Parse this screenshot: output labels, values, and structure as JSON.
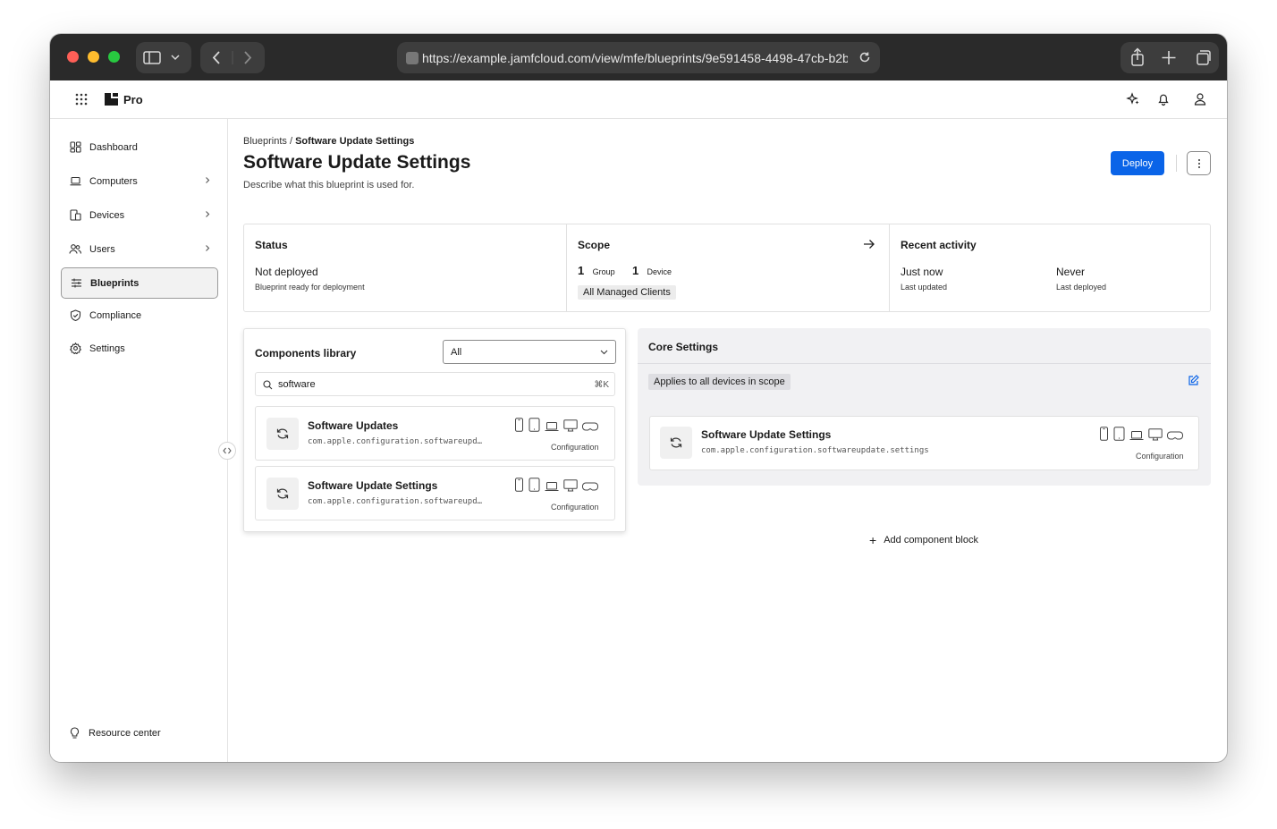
{
  "browser": {
    "url": "https://example.jamfcloud.com/view/mfe/blueprints/9e591458-4498-47cb-b2b"
  },
  "app": {
    "brand": "Pro"
  },
  "sidebar": {
    "items": [
      {
        "label": "Dashboard",
        "icon": "dashboard-icon"
      },
      {
        "label": "Computers",
        "icon": "laptop-icon"
      },
      {
        "label": "Devices",
        "icon": "devices-icon"
      },
      {
        "label": "Users",
        "icon": "users-icon"
      },
      {
        "label": "Blueprints",
        "icon": "sliders-icon"
      },
      {
        "label": "Compliance",
        "icon": "shield-icon"
      },
      {
        "label": "Settings",
        "icon": "gear-icon"
      }
    ],
    "resource_center": "Resource center"
  },
  "page": {
    "breadcrumb_root": "Blueprints",
    "breadcrumb_sep": " / ",
    "breadcrumb_current": "Software Update Settings",
    "title": "Software Update Settings",
    "description": "Describe what this blueprint is used for.",
    "deploy_label": "Deploy"
  },
  "summary": {
    "status": {
      "heading": "Status",
      "value": "Not deployed",
      "sub": "Blueprint ready for deployment"
    },
    "scope": {
      "heading": "Scope",
      "group_count": "1",
      "group_label": "Group",
      "device_count": "1",
      "device_label": "Device",
      "tag": "All Managed Clients"
    },
    "activity": {
      "heading": "Recent activity",
      "updated_value": "Just now",
      "updated_label": "Last updated",
      "deployed_value": "Never",
      "deployed_label": "Last deployed"
    }
  },
  "library": {
    "heading": "Components library",
    "filter_value": "All",
    "search_value": "software",
    "search_shortcut": "⌘K",
    "items": [
      {
        "name": "Software Updates",
        "id": "com.apple.configuration.softwareupd…",
        "type": "Configuration"
      },
      {
        "name": "Software Update Settings",
        "id": "com.apple.configuration.softwareupd…",
        "type": "Configuration"
      }
    ]
  },
  "core": {
    "heading": "Core Settings",
    "applies": "Applies to all devices in scope",
    "block": {
      "name": "Software Update Settings",
      "id": "com.apple.configuration.softwareupdate.settings",
      "type": "Configuration"
    },
    "add_label": "Add component block"
  },
  "colors": {
    "accent": "#0a64e8",
    "chrome": "#2a2a2a"
  }
}
